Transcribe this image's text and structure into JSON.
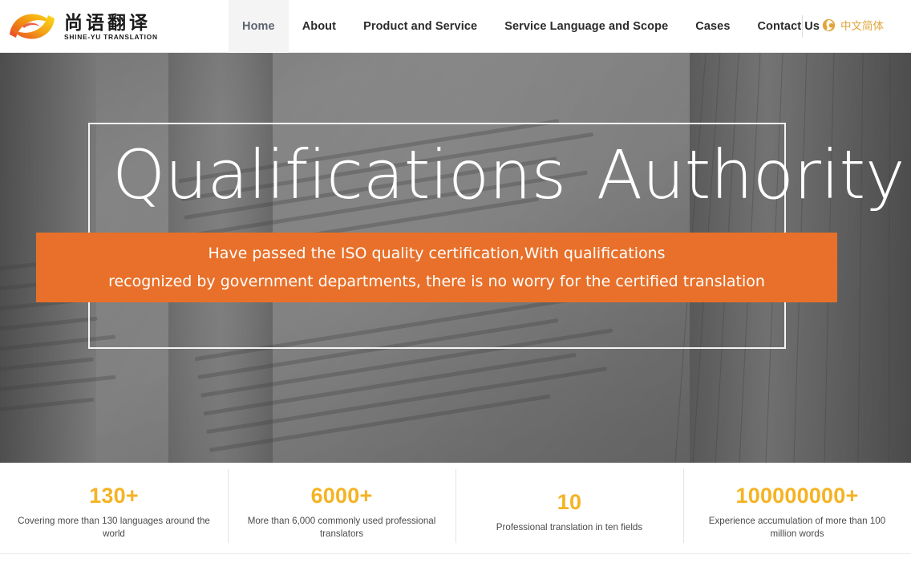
{
  "header": {
    "logo": {
      "icon": "swirl-logo-icon",
      "chinese_name": "尚语翻译",
      "english_name": "SHINE-YU TRANSLATION"
    },
    "nav": [
      {
        "label": "Home",
        "active": true
      },
      {
        "label": "About",
        "active": false
      },
      {
        "label": "Product and Service",
        "active": false
      },
      {
        "label": "Service Language and Scope",
        "active": false
      },
      {
        "label": "Cases",
        "active": false
      },
      {
        "label": "Contact Us",
        "active": false
      }
    ],
    "language_switch": {
      "icon": "globe-icon",
      "label": "中文简体",
      "color": "#e0a63c"
    }
  },
  "hero": {
    "title_part1": "Qualifications",
    "title_part2": "Authority",
    "banner": {
      "line1": "Have passed the ISO quality certification,With qualifications",
      "line2": "recognized by government departments, there is no worry for the certified translation",
      "background_color": "#e8702a"
    }
  },
  "stats": {
    "accent_color": "#f5b324",
    "items": [
      {
        "number": "130+",
        "description": "Covering more than 130 languages around the world"
      },
      {
        "number": "6000+",
        "description": "More than 6,000 commonly used professional translators"
      },
      {
        "number": "10",
        "description": "Professional translation in ten fields"
      },
      {
        "number": "100000000+",
        "description": "Experience accumulation of more than 100 million words"
      }
    ]
  }
}
